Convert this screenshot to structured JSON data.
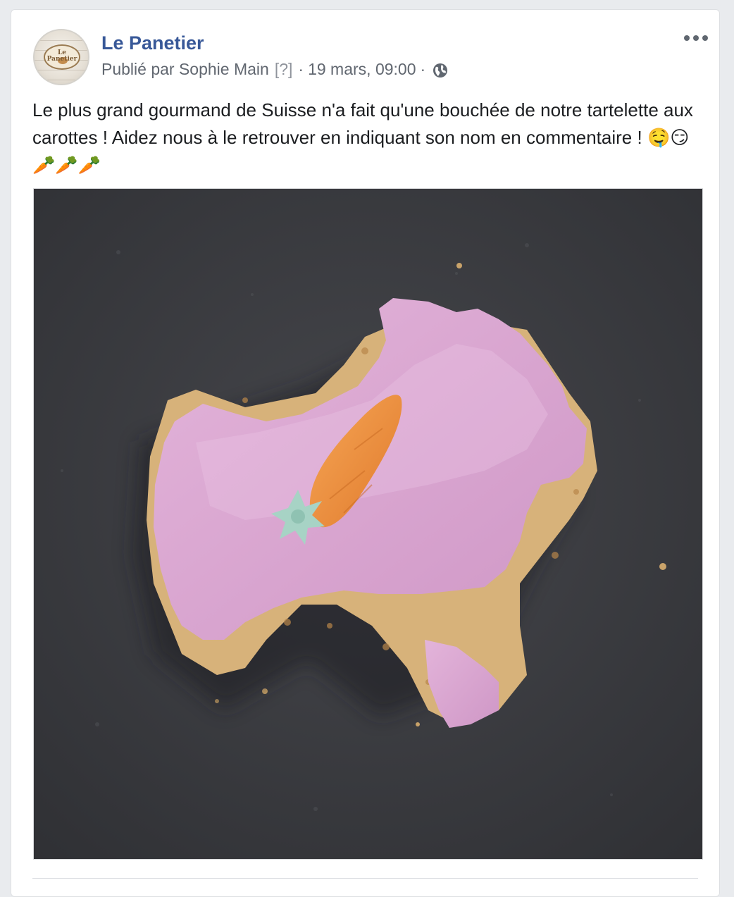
{
  "post": {
    "page_name": "Le Panetier",
    "avatar_logo_text": "Le Panetier",
    "published_by": "Publié par Sophie Main",
    "help_marker": "[?]",
    "separator": "·",
    "date": "19 mars, 09:00",
    "audience_icon": "globe-icon",
    "options_icon": "more-options-icon",
    "text": "Le plus grand gourmand de Suisse n'a fait qu'une bouchée de notre tartelette aux carottes ! Aidez nous à le retrouver en indiquant son nom en commentaire ! ",
    "text_emojis": "🤤😏🥕🥕🥕",
    "photo_subject": "bitten pink-iced carrot tartlet with marzipan carrot on slate"
  },
  "colors": {
    "page_background": "#e9ebee",
    "link_blue": "#385898",
    "meta_gray": "#616770",
    "text": "#1c1e21",
    "icing_pink": "#d9a6cf",
    "slate": "#3a3b40",
    "marzipan_orange": "#e8873a"
  }
}
